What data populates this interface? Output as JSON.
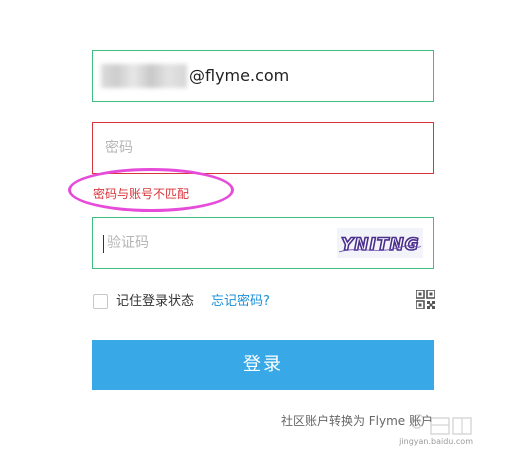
{
  "email": {
    "domain_text": "@flyme.com"
  },
  "password": {
    "placeholder": "密码"
  },
  "error": {
    "message": "密码与账号不匹配"
  },
  "captcha": {
    "placeholder": "验证码",
    "image_text": "YNITNG"
  },
  "remember": {
    "label": "记住登录状态"
  },
  "forgot": {
    "label": "忘记密码?"
  },
  "login": {
    "label": "登录"
  },
  "switch_account": {
    "label": "社区账户转换为 Flyme 账户"
  },
  "watermark": {
    "sub": "jingyan.baidu.com"
  },
  "icons": {
    "qr": "qr-code-icon",
    "checkbox": "checkbox-icon"
  },
  "colors": {
    "field_border_ok": "#3fbf7f",
    "field_border_error": "#d9343a",
    "error_text": "#d9343a",
    "annotation": "#e64bd9",
    "primary_button": "#38a8e6",
    "link": "#1a8fd8"
  }
}
